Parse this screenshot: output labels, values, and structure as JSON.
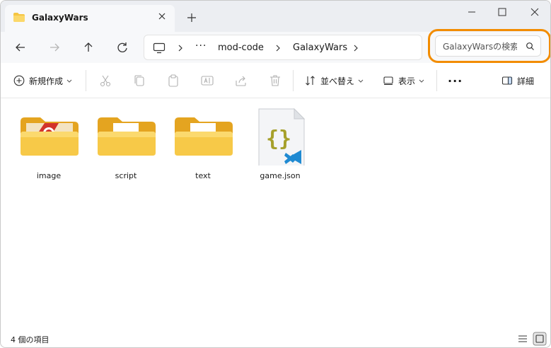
{
  "window": {
    "tab_title": "GalaxyWars",
    "tab_icon": "folder-icon"
  },
  "address": {
    "dots": "···",
    "crumbs": [
      "mod-code",
      "GalaxyWars"
    ]
  },
  "search": {
    "placeholder": "GalaxyWarsの検索"
  },
  "toolbar": {
    "new_label": "新規作成",
    "sort_label": "並べ替え",
    "view_label": "表示",
    "more_label": "···",
    "details_label": "詳細"
  },
  "items": [
    {
      "name": "image",
      "type": "folder",
      "icon": "folder-image-icon"
    },
    {
      "name": "script",
      "type": "folder",
      "icon": "folder-script-icon"
    },
    {
      "name": "text",
      "type": "folder",
      "icon": "folder-text-icon"
    },
    {
      "name": "game.json",
      "type": "file",
      "icon": "json-file-icon"
    }
  ],
  "status": {
    "count_text": "4 個の項目"
  },
  "colors": {
    "accent_ring": "#f28c00",
    "folder_yellow": "#f5c542",
    "json_brace": "#a6a02b",
    "vscode_blue": "#1f8ad2"
  }
}
